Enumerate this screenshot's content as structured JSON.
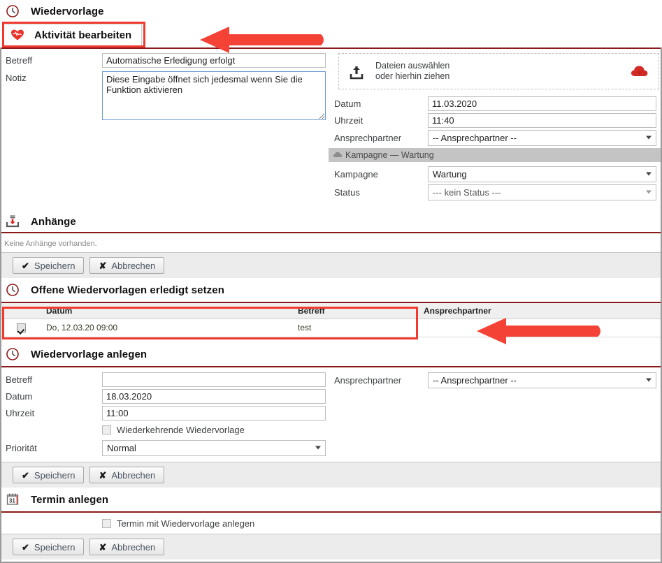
{
  "colors": {
    "accent_rule": "#8B1A1A",
    "annotation_red": "#f03a2e",
    "campaign_bar": "#c4c4c4",
    "button_bar": "#ececec"
  },
  "top_section": {
    "icon": "clock-icon",
    "title": "Wiedervorlage"
  },
  "tab": {
    "icon": "heart-pulse-icon",
    "label": "Aktivität bearbeiten"
  },
  "activity_form": {
    "left": {
      "betreff_label": "Betreff",
      "betreff_value": "Automatische Erledigung erfolgt",
      "notiz_label": "Notiz",
      "notiz_value": "Diese Eingabe öffnet sich jedesmal wenn Sie die Funktion aktivieren"
    },
    "right": {
      "dropzone_line1": "Dateien auswählen",
      "dropzone_line2": "oder hierhin ziehen",
      "dropzone_icon": "upload-tray-icon",
      "cloud_icon": "cloud-upload-icon",
      "datum_label": "Datum",
      "datum_value": "11.03.2020",
      "uhrzeit_label": "Uhrzeit",
      "uhrzeit_value": "11:40",
      "ansprechpartner_label": "Ansprechpartner",
      "ansprechpartner_value": "-- Ansprechpartner --",
      "campaign_bar_icon": "campaign-icon",
      "campaign_bar_text": "Kampagne — Wartung",
      "kampagne_label": "Kampagne",
      "kampagne_value": "Wartung",
      "status_label": "Status",
      "status_value": "--- kein Status ---"
    }
  },
  "attachments": {
    "icon": "inbox-download-icon",
    "title": "Anhänge",
    "empty_text": "Keine Anhänge vorhanden.",
    "save_label": "Speichern",
    "cancel_label": "Abbrechen"
  },
  "open_followups": {
    "icon": "clock-icon",
    "title": "Offene Wiedervorlagen erledigt setzen",
    "columns": [
      "",
      "Datum",
      "Betreff",
      "Ansprechpartner"
    ],
    "rows": [
      {
        "checked": true,
        "datum": "Do, 12.03.20 09:00",
        "betreff": "test",
        "ansprechpartner": ""
      }
    ]
  },
  "create_followup": {
    "icon": "clock-icon",
    "title": "Wiedervorlage anlegen",
    "betreff_label": "Betreff",
    "betreff_value": "",
    "datum_label": "Datum",
    "datum_value": "18.03.2020",
    "uhrzeit_label": "Uhrzeit",
    "uhrzeit_value": "11:00",
    "recurring_label": "Wiederkehrende Wiedervorlage",
    "recurring_checked": false,
    "prioritaet_label": "Priorität",
    "prioritaet_value": "Normal",
    "ansprechpartner_label": "Ansprechpartner",
    "ansprechpartner_value": "-- Ansprechpartner --",
    "save_label": "Speichern",
    "cancel_label": "Abbrechen"
  },
  "create_appointment": {
    "icon": "calendar-31-icon",
    "title": "Termin anlegen",
    "checkbox_label": "Termin mit Wiedervorlage anlegen",
    "checkbox_checked": false,
    "save_label": "Speichern",
    "cancel_label": "Abbrechen"
  }
}
